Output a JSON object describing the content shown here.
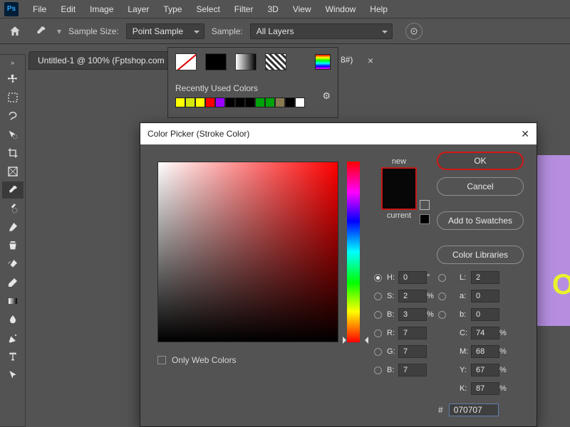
{
  "menu": [
    "File",
    "Edit",
    "Image",
    "Layer",
    "Type",
    "Select",
    "Filter",
    "3D",
    "View",
    "Window",
    "Help"
  ],
  "app_badge": "Ps",
  "options": {
    "sample_size_label": "Sample Size:",
    "sample_size_value": "Point Sample",
    "sample_label": "Sample:",
    "sample_value": "All Layers"
  },
  "document": {
    "tab_fragment_left": "Untitled-1 @ 100% (Fptshop.com",
    "tab_fragment_right": "8#)",
    "close": "×"
  },
  "swatch_panel": {
    "recent_label": "Recently Used Colors",
    "recent": [
      "#ffff00",
      "#d6e80a",
      "#ffff00",
      "#ff0000",
      "#9b00ff",
      "#000000",
      "#000000",
      "#000000",
      "#00a20a",
      "#00a20a",
      "#8a7a52",
      "#000000",
      "#ffffff"
    ]
  },
  "picker": {
    "title": "Color Picker (Stroke Color)",
    "buttons": {
      "ok": "OK",
      "cancel": "Cancel",
      "add": "Add to Swatches",
      "libs": "Color Libraries"
    },
    "new_label": "new",
    "current_label": "current",
    "only_web": "Only Web Colors",
    "values": {
      "H": "0",
      "S": "2",
      "Bv": "3",
      "R": "7",
      "G": "7",
      "Bc": "7",
      "L": "2",
      "a": "0",
      "b": "0",
      "C": "74",
      "M": "68",
      "Y": "67",
      "K": "87",
      "hex": "070707"
    },
    "labels": {
      "H": "H:",
      "S": "S:",
      "B": "B:",
      "R": "R:",
      "G": "G:",
      "Bc": "B:",
      "L": "L:",
      "a": "a:",
      "b": "b:",
      "C": "C:",
      "M": "M:",
      "Y": "Y:",
      "K": "K:",
      "deg": "°",
      "pct": "%",
      "hash": "#"
    }
  },
  "tools": [
    "move-icon",
    "rect-marquee-icon",
    "lasso-icon",
    "quick-select-icon",
    "crop-icon",
    "frame-icon",
    "eyedropper-icon",
    "spot-heal-icon",
    "brush-icon",
    "clone-icon",
    "history-brush-icon",
    "eraser-icon",
    "gradient-icon",
    "blur-icon",
    "pen-icon",
    "type-icon",
    "path-select-icon"
  ]
}
